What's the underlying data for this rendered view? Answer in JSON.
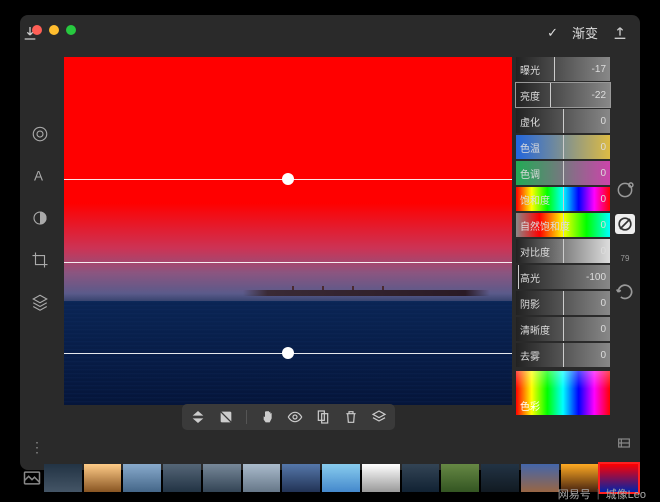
{
  "topbar": {
    "mode_label": "渐变",
    "checkmark": "✓"
  },
  "sliders": [
    {
      "label": "曝光",
      "value": "-17",
      "pos": 40,
      "grad": "linear-gradient(to right,#222,#888)"
    },
    {
      "label": "亮度",
      "value": "-22",
      "pos": 36,
      "grad": "linear-gradient(to right,#222,#888)",
      "selected": true
    },
    {
      "label": "虚化",
      "value": "0",
      "pos": 50,
      "grad": "linear-gradient(to right,#222,#888)"
    },
    {
      "label": "色温",
      "value": "0",
      "pos": 50,
      "grad": "linear-gradient(to right,#2266dd,#ddbb44)"
    },
    {
      "label": "色调",
      "value": "0",
      "pos": 50,
      "grad": "linear-gradient(to right,#22aa55,#cc44aa)"
    },
    {
      "label": "饱和度",
      "value": "0",
      "pos": 50,
      "grad": "linear-gradient(to right,#ff0000,#ffff00,#00ff00,#00ffff,#0000ff,#ff00ff,#ff0000)"
    },
    {
      "label": "自然饱和度",
      "value": "0",
      "pos": 50,
      "grad": "linear-gradient(to right,#888,#ff0000,#ffff00,#00ff00,#00ffff)"
    },
    {
      "label": "对比度",
      "value": "0",
      "pos": 50,
      "grad": "linear-gradient(to right,#222,#ddd)"
    },
    {
      "label": "高光",
      "value": "-100",
      "pos": 2,
      "grad": "linear-gradient(to right,#222,#888)"
    },
    {
      "label": "阴影",
      "value": "0",
      "pos": 50,
      "grad": "linear-gradient(to right,#222,#888)"
    },
    {
      "label": "清晰度",
      "value": "0",
      "pos": 50,
      "grad": "linear-gradient(to right,#222,#888)"
    },
    {
      "label": "去雾",
      "value": "0",
      "pos": 50,
      "grad": "linear-gradient(to right,#222,#888)"
    }
  ],
  "color_picker_label": "色彩",
  "right_tools_badge": "79",
  "thumbs": [
    {
      "bg": "linear-gradient(#234,#456)"
    },
    {
      "bg": "linear-gradient(#ffcc88,#885522)"
    },
    {
      "bg": "linear-gradient(#88aacc,#446688)"
    },
    {
      "bg": "linear-gradient(#556677,#223344)"
    },
    {
      "bg": "linear-gradient(#778899,#334455)"
    },
    {
      "bg": "linear-gradient(#aabbcc,#667788)"
    },
    {
      "bg": "linear-gradient(#5577aa,#223355)"
    },
    {
      "bg": "linear-gradient(#88ccee,#4488cc)"
    },
    {
      "bg": "linear-gradient(#fff,#999)"
    },
    {
      "bg": "linear-gradient(#334455,#112233)"
    },
    {
      "bg": "linear-gradient(#668844,#335522)"
    },
    {
      "bg": "linear-gradient(#223344,#111a22)"
    },
    {
      "bg": "linear-gradient(#4466aa,#996644)"
    },
    {
      "bg": "linear-gradient(#ffaa22,#442211)"
    },
    {
      "bg": "linear-gradient(#ff0000,#0022aa)",
      "selected": true
    }
  ],
  "watermark": {
    "brand": "网易号",
    "author": "城像Leo"
  }
}
